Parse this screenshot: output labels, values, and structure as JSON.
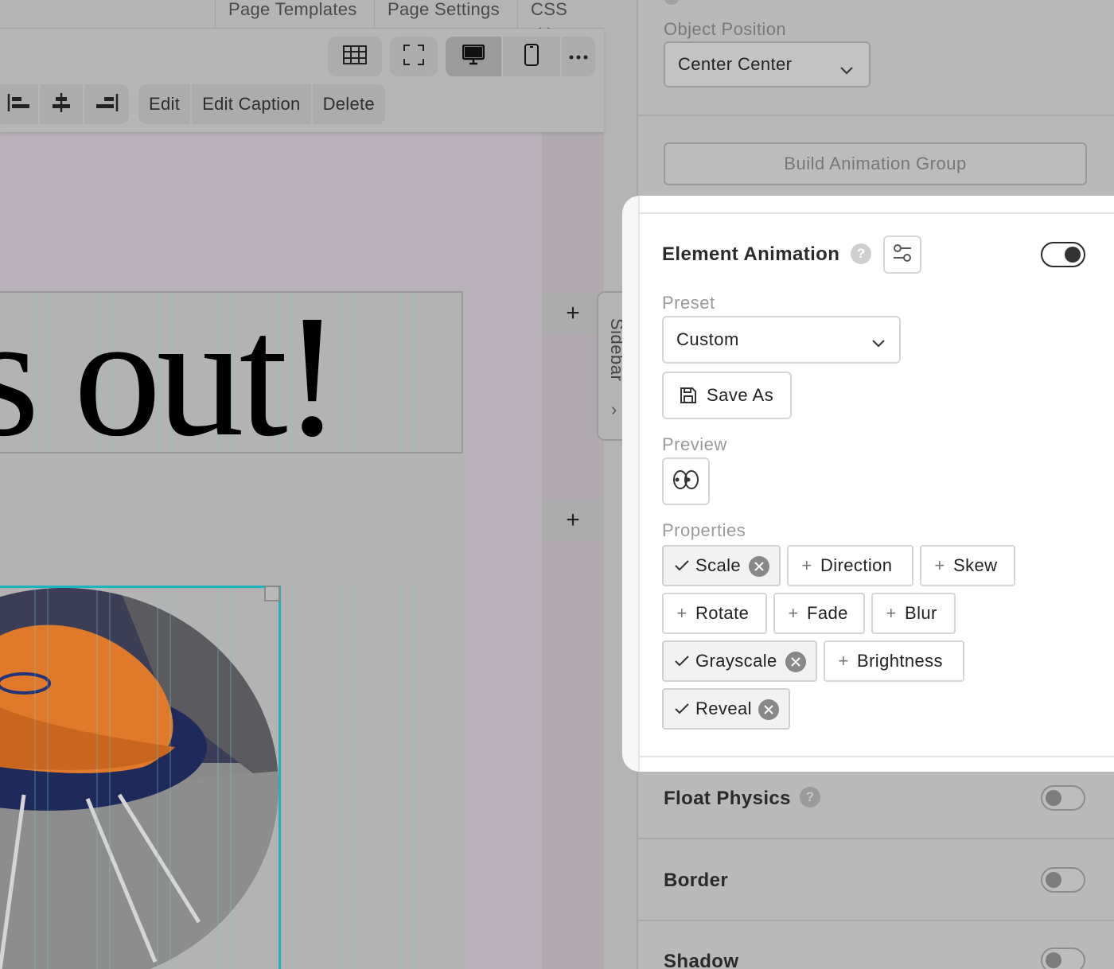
{
  "top_menu": {
    "items": [
      "Page Templates",
      "Page Settings",
      "CSS"
    ]
  },
  "toolbar": {
    "view_buttons": [
      "grid-view",
      "fullscreen",
      "desktop",
      "mobile",
      "more"
    ],
    "text_actions": [
      "Edit",
      "Edit Caption",
      "Delete"
    ]
  },
  "canvas": {
    "heading_text": "s out!",
    "plus_symbol": "+"
  },
  "sidebar_tab": {
    "label": "Sidebar",
    "arrow": "›"
  },
  "panel": {
    "object_position": {
      "label": "Object Position",
      "value": "Center Center"
    },
    "build_animation_group": "Build Animation Group",
    "element_animation": {
      "title": "Element Animation",
      "help": "?",
      "enabled": true,
      "preset_label": "Preset",
      "preset_value": "Custom",
      "save_as": "Save As",
      "preview_label": "Preview",
      "properties_label": "Properties",
      "properties": [
        {
          "label": "Scale",
          "selected": true
        },
        {
          "label": "Direction",
          "selected": false
        },
        {
          "label": "Skew",
          "selected": false
        },
        {
          "label": "Rotate",
          "selected": false
        },
        {
          "label": "Fade",
          "selected": false
        },
        {
          "label": "Blur",
          "selected": false
        },
        {
          "label": "Grayscale",
          "selected": true
        },
        {
          "label": "Brightness",
          "selected": false
        },
        {
          "label": "Reveal",
          "selected": true
        }
      ]
    },
    "float_physics": {
      "title": "Float Physics",
      "help": "?",
      "enabled": false
    },
    "border": {
      "title": "Border",
      "enabled": false
    },
    "shadow": {
      "title": "Shadow",
      "enabled": false
    }
  },
  "colors": {
    "accent_outline": "#1bb3c0",
    "overlay": "#b9b9b9",
    "card_background": "#ffffff"
  }
}
